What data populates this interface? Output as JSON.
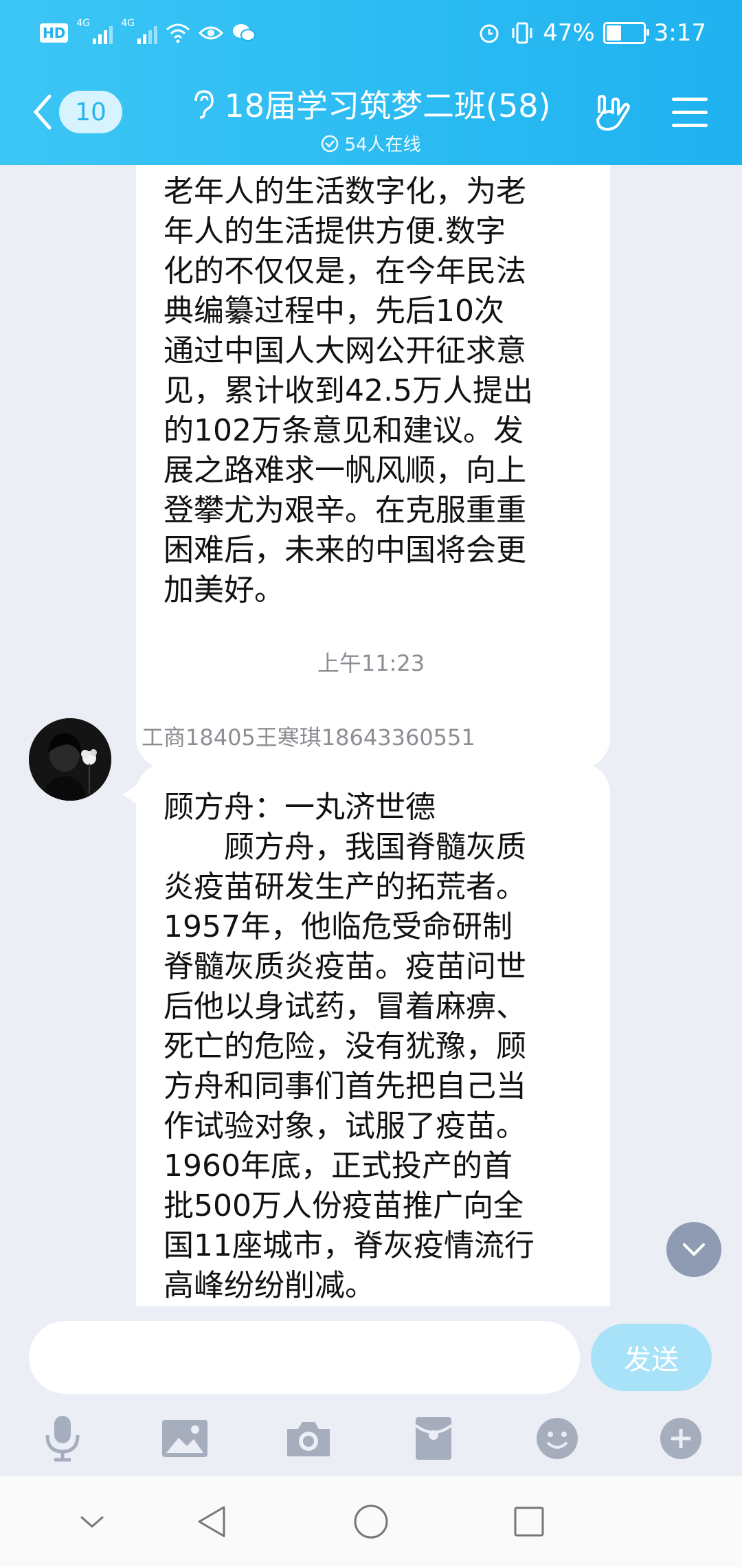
{
  "status_bar": {
    "hd": "HD",
    "sim1": "4G",
    "sim2": "4G",
    "battery_percent": "47%",
    "battery_level": 0.47,
    "time": "3:17"
  },
  "header": {
    "back_count": "10",
    "title": "18届学习筑梦二班(58)",
    "subtitle": "54人在线"
  },
  "messages": [
    {
      "lines": [
        "老年人的生活数字化，为老",
        "年人的生活提供方便.数字",
        "化的不仅仅是，在今年民法",
        "典编纂过程中，先后10次",
        "通过中国人大网公开征求意",
        "见，累计收到42.5万人提出",
        "的102万条意见和建议。发",
        "展之路难求一帆风顺，向上",
        "登攀尤为艰辛。在克服重重",
        "困难后，未来的中国将会更",
        "加美好。"
      ]
    },
    {
      "time": "上午11:23",
      "sender": "工商18405王寒琪18643360551",
      "lines": [
        "顾方舟：一丸济世德",
        "　　顾方舟，我国脊髓灰质",
        "炎疫苗研发生产的拓荒者。",
        "1957年，他临危受命研制",
        "脊髓灰质炎疫苗。疫苗问世",
        "后他以身试药，冒着麻痹、",
        "死亡的危险，没有犹豫，顾",
        "方舟和同事们首先把自己当",
        "作试验对象，试服了疫苗。",
        "1960年底，正式投产的首",
        "批500万人份疫苗推广向全",
        "国11座城市，脊灰疫情流行",
        "高峰纷纷削减。"
      ]
    }
  ],
  "input": {
    "value": "",
    "send_label": "发送"
  },
  "toolbar": [
    "voice-icon",
    "image-icon",
    "camera-icon",
    "redpacket-icon",
    "emoji-icon",
    "plus-icon"
  ],
  "colors": {
    "header": "#1fb2f0",
    "background": "#eceef6",
    "send_button": "#a8e2f8"
  }
}
